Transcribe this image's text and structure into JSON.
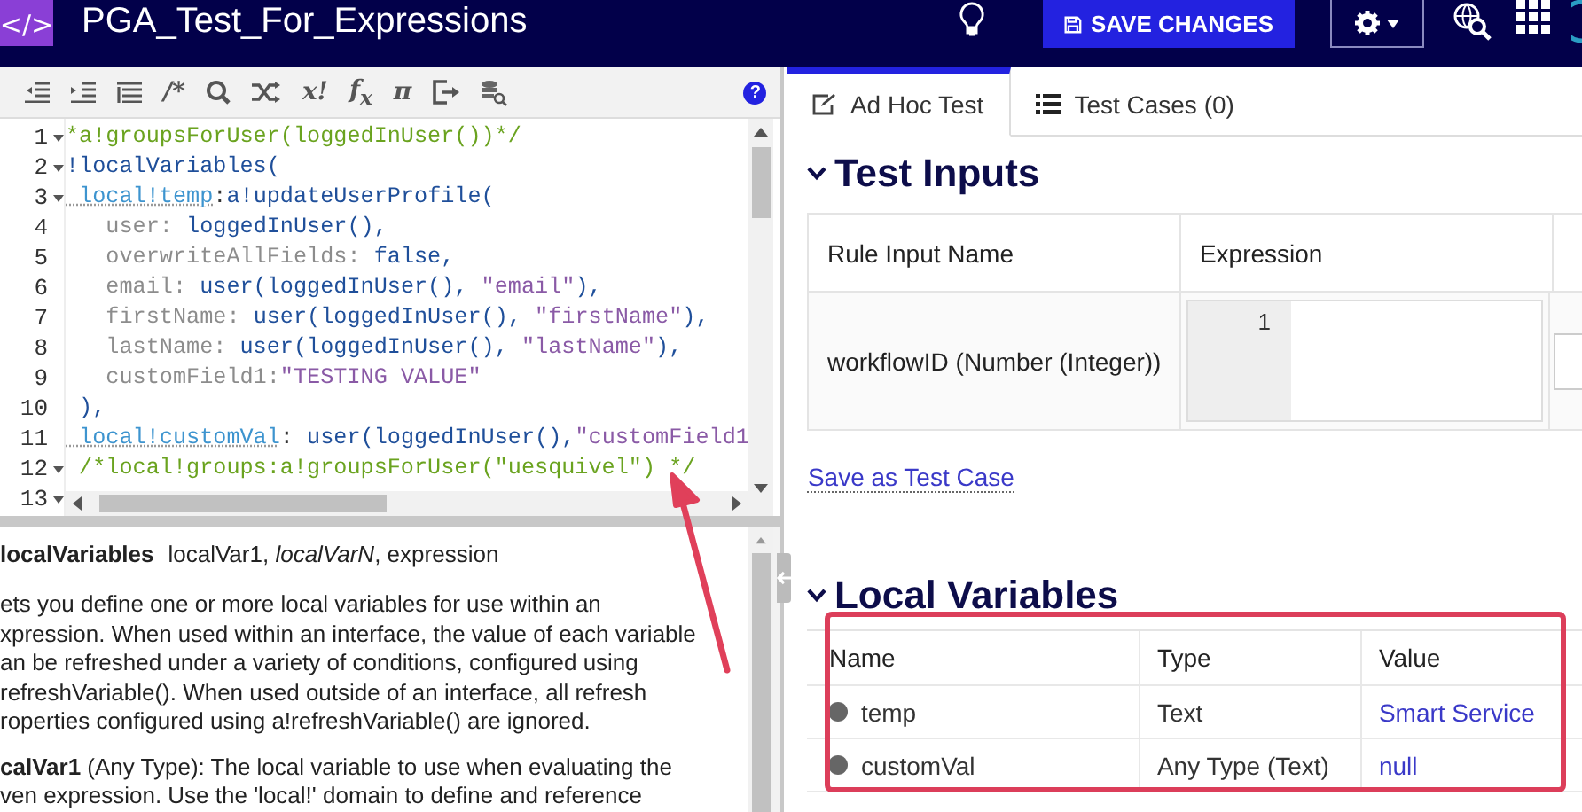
{
  "header": {
    "logo": "</>",
    "title": "PGA_Test_For_Expressions",
    "save_button": "SAVE CHANGES"
  },
  "toolbar": [
    {
      "kind": "outdent"
    },
    {
      "kind": "indent"
    },
    {
      "kind": "format"
    },
    {
      "kind": "glyph",
      "text": "/*"
    },
    {
      "kind": "search"
    },
    {
      "kind": "shuffle"
    },
    {
      "kind": "glyph",
      "text": "x!"
    },
    {
      "kind": "glyph",
      "text": "f$_{x}$"
    },
    {
      "kind": "glyph",
      "text": "π"
    },
    {
      "kind": "export"
    },
    {
      "kind": "database"
    }
  ],
  "help": "?",
  "editor": {
    "lines": [
      {
        "number": "1",
        "foldable": true,
        "segments": [
          {
            "kind": "comment",
            "text": "*a!groupsForUser(loggedInUser())*/"
          }
        ]
      },
      {
        "number": "2",
        "foldable": true,
        "segments": [
          {
            "kind": "func",
            "text": "!localVariables("
          }
        ]
      },
      {
        "number": "3",
        "foldable": true,
        "segments": [
          {
            "kind": "var",
            "text": " local!temp"
          },
          {
            "kind": "plain",
            "text": ":"
          },
          {
            "kind": "func",
            "text": "a!updateUserProfile("
          }
        ]
      },
      {
        "number": "4",
        "foldable": false,
        "segments": [
          {
            "kind": "param",
            "text": "   user: "
          },
          {
            "kind": "func",
            "text": "loggedInUser(),"
          }
        ]
      },
      {
        "number": "5",
        "foldable": false,
        "segments": [
          {
            "kind": "param",
            "text": "   overwriteAllFields: "
          },
          {
            "kind": "func",
            "text": "false,"
          }
        ]
      },
      {
        "number": "6",
        "foldable": false,
        "segments": [
          {
            "kind": "param",
            "text": "   email: "
          },
          {
            "kind": "func",
            "text": "user(loggedInUser(), "
          },
          {
            "kind": "string",
            "text": "\"email\""
          },
          {
            "kind": "func",
            "text": "),"
          }
        ]
      },
      {
        "number": "7",
        "foldable": false,
        "segments": [
          {
            "kind": "param",
            "text": "   firstName: "
          },
          {
            "kind": "func",
            "text": "user(loggedInUser(), "
          },
          {
            "kind": "string",
            "text": "\"firstName\""
          },
          {
            "kind": "func",
            "text": "),"
          }
        ]
      },
      {
        "number": "8",
        "foldable": false,
        "segments": [
          {
            "kind": "param",
            "text": "   lastName: "
          },
          {
            "kind": "func",
            "text": "user(loggedInUser(), "
          },
          {
            "kind": "string",
            "text": "\"lastName\""
          },
          {
            "kind": "func",
            "text": "),"
          }
        ]
      },
      {
        "number": "9",
        "foldable": false,
        "segments": [
          {
            "kind": "param",
            "text": "   customField1:"
          },
          {
            "kind": "string",
            "text": "\"TESTING VALUE\""
          }
        ]
      },
      {
        "number": "10",
        "foldable": false,
        "segments": [
          {
            "kind": "func",
            "text": " ),"
          }
        ]
      },
      {
        "number": "11",
        "foldable": false,
        "segments": [
          {
            "kind": "var",
            "text": " local!customVal"
          },
          {
            "kind": "plain",
            "text": ": "
          },
          {
            "kind": "func",
            "text": "user(loggedInUser(),"
          },
          {
            "kind": "string",
            "text": "\"customField1"
          }
        ]
      },
      {
        "number": "12",
        "foldable": true,
        "segments": [
          {
            "kind": "comment",
            "text": " /*local!groups:a!groupsForUser(\"uesquivel\") */"
          }
        ]
      },
      {
        "number": "13",
        "foldable": true
      }
    ]
  },
  "docs": {
    "name": "localVariables",
    "params": "localVar1, *localVarN*, expression",
    "paragraphs": [
      [
        "ets you define one or more local variables for use within an",
        "xpression. When used within an interface, the value of each variable",
        "an be refreshed under a variety of conditions, configured using",
        "refreshVariable(). When used outside of an interface, all refresh",
        "roperties configured using a!refreshVariable() are ignored."
      ],
      [
        "**calVar1** (Any Type): The local variable to use when evaluating the",
        "ven expression. Use the 'local!' domain to define and reference"
      ]
    ]
  },
  "tabs": [
    {
      "label": "Ad Hoc Test",
      "selected": true
    },
    {
      "label": "Test Cases (0)",
      "selected": false
    }
  ],
  "test_inputs": {
    "title": "Test Inputs",
    "expanded": true,
    "columns": [
      "Rule Input Name",
      "Expression"
    ],
    "rows": [
      {
        "name": "workflowID (Number (Integer))",
        "line_number": "1"
      }
    ]
  },
  "save_link": "Save as Test Case",
  "local_variables": {
    "title": "Local Variables",
    "expanded": true,
    "columns": [
      "Name",
      "Type",
      "Value"
    ],
    "rows": [
      {
        "name": "temp",
        "type": "Text",
        "value": "Smart Service"
      },
      {
        "name": "customVal",
        "type": "Any Type (Text)",
        "value": "null"
      }
    ]
  }
}
